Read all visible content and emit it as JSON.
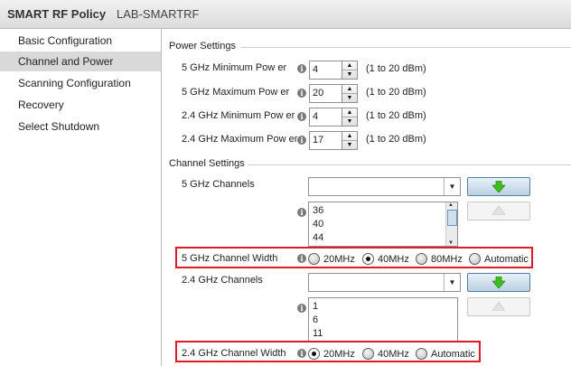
{
  "header": {
    "title": "SMART RF Policy",
    "policy_name": "LAB-SMARTRF"
  },
  "sidebar": {
    "items": [
      {
        "label": "Basic Configuration"
      },
      {
        "label": "Channel and Power"
      },
      {
        "label": "Scanning Configuration"
      },
      {
        "label": "Recovery"
      },
      {
        "label": "Select Shutdown"
      }
    ]
  },
  "power": {
    "title": "Power Settings",
    "rows": [
      {
        "label": "5 GHz Minimum Pow er",
        "value": "4",
        "range": "(1 to 20 dBm)"
      },
      {
        "label": "5 GHz Maximum Pow er",
        "value": "20",
        "range": "(1 to 20 dBm)"
      },
      {
        "label": "2.4 GHz Minimum Pow er",
        "value": "4",
        "range": "(1 to 20 dBm)"
      },
      {
        "label": "2.4 GHz Maximum Pow er",
        "value": "17",
        "range": "(1 to 20 dBm)"
      }
    ]
  },
  "channel": {
    "title": "Channel Settings",
    "g5": {
      "label": "5 GHz Channels",
      "selected": "",
      "list": [
        "36",
        "40",
        "44"
      ],
      "width_label": "5 GHz Channel Width",
      "width_options": [
        "20MHz",
        "40MHz",
        "80MHz",
        "Automatic"
      ],
      "width_selected": "40MHz"
    },
    "g24": {
      "label": "2.4 GHz Channels",
      "selected": "",
      "list": [
        "1",
        "6",
        "11"
      ],
      "width_label": "2.4 GHz Channel Width",
      "width_options": [
        "20MHz",
        "40MHz",
        "Automatic"
      ],
      "width_selected": "20MHz"
    }
  },
  "icons": {
    "info": "i",
    "spin_up": "▲",
    "spin_down": "▼",
    "combo_arrow": "▼"
  },
  "colors": {
    "highlight": "#e21b2b",
    "add_arrow": "#3fbf1f"
  }
}
